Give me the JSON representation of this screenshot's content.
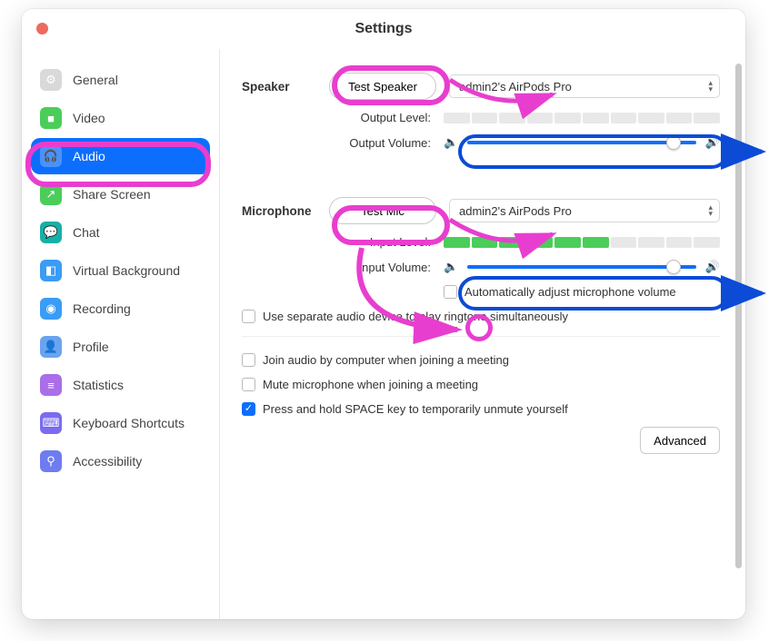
{
  "window": {
    "title": "Settings"
  },
  "sidebar": {
    "items": [
      {
        "label": "General",
        "icon": "gear-icon",
        "bg": "#d9d9d9"
      },
      {
        "label": "Video",
        "icon": "video-icon",
        "bg": "#4bcd5a"
      },
      {
        "label": "Audio",
        "icon": "headphones-icon",
        "bg": "#0d6efd",
        "active": true
      },
      {
        "label": "Share Screen",
        "icon": "share-icon",
        "bg": "#4bcd5a"
      },
      {
        "label": "Chat",
        "icon": "chat-icon",
        "bg": "#17b0a6"
      },
      {
        "label": "Virtual Background",
        "icon": "virtualbg-icon",
        "bg": "#3a9cf5"
      },
      {
        "label": "Recording",
        "icon": "record-icon",
        "bg": "#3a9cf5"
      },
      {
        "label": "Profile",
        "icon": "profile-icon",
        "bg": "#6aa4ef"
      },
      {
        "label": "Statistics",
        "icon": "stats-icon",
        "bg": "#a96ee8"
      },
      {
        "label": "Keyboard Shortcuts",
        "icon": "keyboard-icon",
        "bg": "#7a6cf0"
      },
      {
        "label": "Accessibility",
        "icon": "accessibility-icon",
        "bg": "#6e7cf0"
      }
    ]
  },
  "audio": {
    "speaker": {
      "section_label": "Speaker",
      "test_label": "Test Speaker",
      "device": "admin2's AirPods Pro",
      "output_level_label": "Output Level:",
      "output_level_segments": 10,
      "output_level_active": 0,
      "output_volume_label": "Output Volume:",
      "output_volume_percent": 90
    },
    "mic": {
      "section_label": "Microphone",
      "test_label": "Test Mic",
      "device": "admin2's AirPods Pro",
      "input_level_label": "Input Level:",
      "input_level_segments": 10,
      "input_level_active": 6,
      "input_volume_label": "Input Volume:",
      "input_volume_percent": 90,
      "auto_adjust_label": "Automatically adjust microphone volume",
      "auto_adjust_checked": false
    },
    "separate_device_label": "Use separate audio device to play ringtone simultaneously",
    "separate_device_checked": false,
    "join_audio_label": "Join audio by computer when joining a meeting",
    "join_audio_checked": false,
    "mute_on_join_label": "Mute microphone when joining a meeting",
    "mute_on_join_checked": false,
    "space_unmute_label": "Press and hold SPACE key to temporarily unmute yourself",
    "space_unmute_checked": true,
    "advanced_label": "Advanced"
  },
  "annotations": {
    "color_pink": "#e83ecf",
    "color_blue": "#0b4bd6"
  }
}
